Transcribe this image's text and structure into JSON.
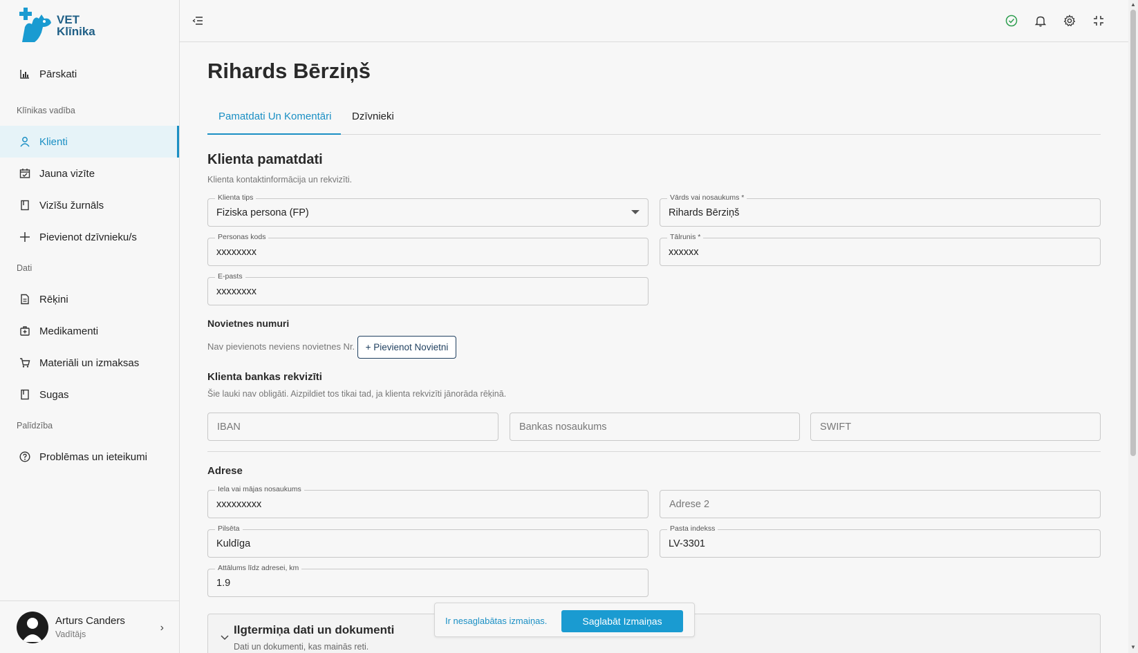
{
  "brand": {
    "line1": "VET",
    "line2": "Klīnika",
    "color": "#1f5f86"
  },
  "sidebar": {
    "items": [
      {
        "label": "Pārskati",
        "icon": "bar-chart-icon"
      },
      {
        "label": "Klienti",
        "icon": "user-icon",
        "active": true
      },
      {
        "label": "Jauna vizīte",
        "icon": "calendar-check-icon"
      },
      {
        "label": "Vizīšu žurnāls",
        "icon": "book-icon"
      },
      {
        "label": "Pievienot dzīvnieku/s",
        "icon": "plus-icon"
      },
      {
        "label": "Rēķini",
        "icon": "file-text-icon"
      },
      {
        "label": "Medikamenti",
        "icon": "medical-bag-icon"
      },
      {
        "label": "Materiāli un izmaksas",
        "icon": "cart-icon"
      },
      {
        "label": "Sugas",
        "icon": "book-icon"
      },
      {
        "label": "Problēmas un ieteikumi",
        "icon": "help-circle-icon"
      }
    ],
    "sections": [
      "Klīnikas vadība",
      "Dati",
      "Palīdzība"
    ]
  },
  "user": {
    "name": "Arturs Canders",
    "role": "Vadītājs"
  },
  "topbar": {
    "icons": [
      "menu-collapse-icon",
      "status-ok-icon",
      "bell-icon",
      "gear-icon",
      "fullscreen-exit-icon"
    ]
  },
  "page": {
    "title": "Rihards Bērziņš"
  },
  "tabs": [
    {
      "label": "Pamatdati Un Komentāri",
      "active": true
    },
    {
      "label": "Dzīvnieki",
      "active": false
    }
  ],
  "client_basic": {
    "title": "Klienta pamatdati",
    "subtitle": "Klienta kontaktinformācija un rekvizīti.",
    "client_type": {
      "label": "Klienta tips",
      "value": "Fiziska persona (FP)"
    },
    "name": {
      "label": "Vārds vai nosaukums *",
      "value": "Rihards Bērziņš"
    },
    "personal_code": {
      "label": "Personas kods",
      "value": "xxxxxxxx"
    },
    "phone": {
      "label": "Tālrunis *",
      "value": "xxxxxx"
    },
    "email": {
      "label": "E-pasts",
      "value": "xxxxxxxx"
    }
  },
  "stall": {
    "title": "Novietnes numuri",
    "empty_note": "Nav pievienots neviens novietnes Nr.",
    "add_button": "+ Pievienot Novietni"
  },
  "bank": {
    "title": "Klienta bankas rekvizīti",
    "subtitle": "Šie lauki nav obligāti. Aizpildiet tos tikai tad, ja klienta rekvizīti jānorāda rēķinā.",
    "iban_placeholder": "IBAN",
    "bank_name_placeholder": "Bankas nosaukums",
    "swift_placeholder": "SWIFT"
  },
  "address": {
    "title": "Adrese",
    "street": {
      "label": "Iela vai mājas nosaukums",
      "value": "xxxxxxxxx"
    },
    "address2_placeholder": "Adrese 2",
    "city": {
      "label": "Pilsēta",
      "value": "Kuldīga"
    },
    "postal": {
      "label": "Pasta indekss",
      "value": "LV-3301"
    },
    "distance": {
      "label": "Attālums līdz adresei, km",
      "value": "1.9"
    }
  },
  "long_term": {
    "title": "Ilgtermiņa dati un dokumenti",
    "subtitle": "Dati un dokumenti, kas mainās reti."
  },
  "save_bar": {
    "message": "Ir nesaglabātas izmaiņas.",
    "button": "Saglabāt Izmaiņas"
  },
  "colors": {
    "accent": "#1a8fc4",
    "save_button": "#1a9bd1",
    "status_ok": "#2e9e4f"
  }
}
